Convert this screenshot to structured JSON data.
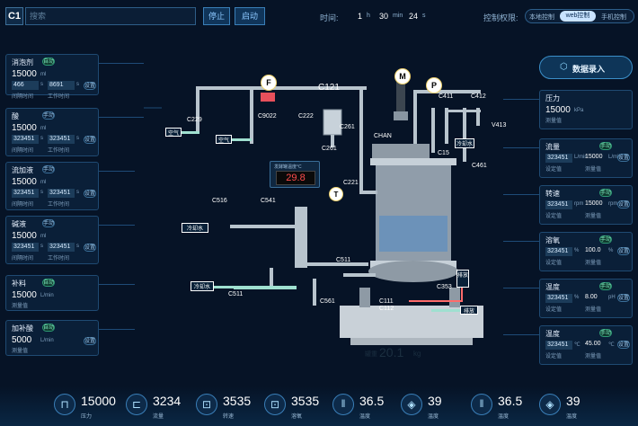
{
  "header": {
    "c1": "C1",
    "search_placeholder": "搜索",
    "btn1": "停止",
    "btn2": "启动",
    "time_label": "时间:",
    "time_h": "1",
    "time_h_unit": "h",
    "time_m": "30",
    "time_m_unit": "min",
    "time_s": "24",
    "time_s_unit": "s",
    "control_label": "控制权限:",
    "ctrl_local": "本地控制",
    "ctrl_web": "web控制",
    "ctrl_mobile": "手机控制"
  },
  "left_panels": [
    {
      "title": "消泡剂",
      "tag": "自动",
      "val": "15000",
      "unit": "ml",
      "f1": "466",
      "f1u": "s",
      "f2": "8691",
      "f2u": "s",
      "btn": "设置",
      "l1": "间隔时间",
      "l2": "工作时间"
    },
    {
      "title": "酸",
      "tag": "手动",
      "val": "15000",
      "unit": "ml",
      "f1": "323451",
      "f1u": "s",
      "f2": "323451",
      "f2u": "s",
      "btn": "设置",
      "l1": "间隔时间",
      "l2": "工作时间"
    },
    {
      "title": "流加液",
      "tag": "手动",
      "val": "15000",
      "unit": "ml",
      "f1": "323451",
      "f1u": "s",
      "f2": "323451",
      "f2u": "s",
      "btn": "设置",
      "l1": "间隔时间",
      "l2": "工作时间"
    },
    {
      "title": "碱液",
      "tag": "手动",
      "val": "15000",
      "unit": "ml",
      "f1": "323451",
      "f1u": "s",
      "f2": "323451",
      "f2u": "s",
      "btn": "设置",
      "l1": "间隔时间",
      "l2": "工作时间"
    },
    {
      "title": "补料",
      "tag": "自动",
      "val": "15000",
      "unit": "L/min",
      "sub": "测量值"
    },
    {
      "title": "加补酸",
      "tag": "自动",
      "val": "5000",
      "unit": "L/min",
      "sub": "测量值",
      "btn": "设置"
    }
  ],
  "right_panels": [
    {
      "title": "压力",
      "val": "15000",
      "unit": "kPa",
      "sub": "测量值"
    },
    {
      "title": "流量",
      "tag": "手动",
      "f1": "323451",
      "f1u": "L/min",
      "v2": "15000",
      "v2u": "L/min",
      "btn": "设置",
      "l1": "设定值",
      "l2": "测量值"
    },
    {
      "title": "转速",
      "tag": "手动",
      "f1": "323451",
      "f1u": "rpm",
      "v2": "15000",
      "v2u": "rpm",
      "btn": "设置",
      "l1": "设定值",
      "l2": "测量值"
    },
    {
      "title": "溶氧",
      "tag": "手动",
      "f1": "323451",
      "f1u": "%",
      "v2": "100.0",
      "v2u": "%",
      "btn": "设置",
      "l1": "设定值",
      "l2": "测量值"
    },
    {
      "title": "温度",
      "tag": "手动",
      "f1": "323451",
      "f1u": "%",
      "v2": "8.00",
      "v2u": "pH",
      "btn": "设置",
      "l1": "设定值",
      "l2": "测量值"
    },
    {
      "title": "温度",
      "tag": "手动",
      "f1": "323451",
      "f1u": "℃",
      "v2": "45.00",
      "v2u": "℃",
      "btn": "设置",
      "l1": "设定值",
      "l2": "测量值"
    }
  ],
  "data_entry": "数据录入",
  "diagram": {
    "F": "F",
    "M": "M",
    "P": "P",
    "T": "T",
    "C121": "C121",
    "C229": "C229",
    "C9022": "C9022",
    "C222": "C222",
    "C261a": "C261",
    "C261b": "C261",
    "C411": "C411",
    "C412": "C412",
    "V413": "V413",
    "C15": "C15",
    "C461": "C461",
    "CHAN": "CHAN",
    "air1": "空气",
    "air2": "空气",
    "cool_water": "冷却水",
    "temp_label": "发酵罐温度°C",
    "temp_value": "29.8",
    "C516": "C516",
    "C541": "C541",
    "C221": "C221",
    "C511a": "C511",
    "C511b": "C511",
    "cool_in": "冷却水",
    "cool_in2": "冷却水",
    "C561": "C561",
    "C111": "C111",
    "C112": "C112",
    "C353": "C353",
    "exhaust": "排放",
    "vent": "排放",
    "tank_weight": "20.1",
    "tank_weight_unit": "kg",
    "tank_label": "罐重"
  },
  "bottom": [
    {
      "icon": "pressure-icon",
      "val": "15000",
      "lbl": "压力"
    },
    {
      "icon": "flow-icon",
      "val": "3234",
      "lbl": "流量"
    },
    {
      "icon": "speed-icon",
      "val": "3535",
      "lbl": "转速"
    },
    {
      "icon": "oxygen-icon",
      "val": "3535",
      "lbl": "溶氧"
    },
    {
      "icon": "thermometer-icon",
      "val": "36.5",
      "lbl": "温度"
    },
    {
      "icon": "ph-icon",
      "val": "39",
      "lbl": "温度"
    },
    {
      "icon": "thermometer-icon",
      "val": "36.5",
      "lbl": "温度"
    },
    {
      "icon": "ph-icon",
      "val": "39",
      "lbl": "温度"
    }
  ]
}
